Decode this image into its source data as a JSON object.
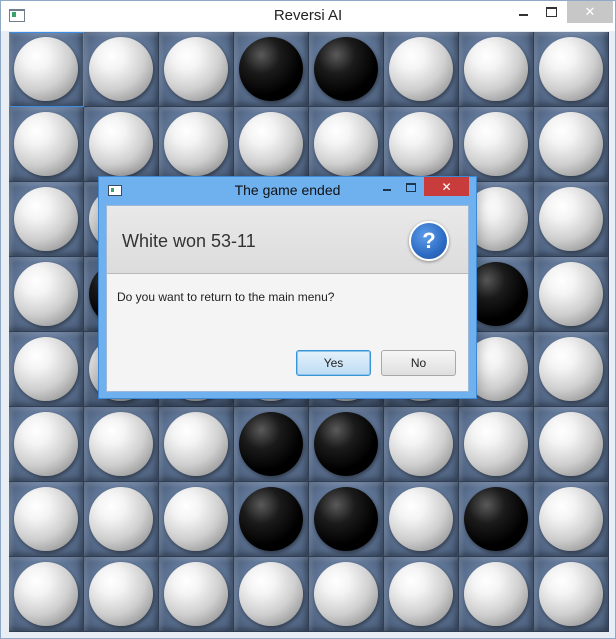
{
  "window": {
    "title": "Reversi AI",
    "close_glyph": "✕"
  },
  "board": {
    "rows": 8,
    "cols": 8,
    "selected_cell": [
      0,
      0
    ],
    "cells": [
      [
        "white",
        "white",
        "white",
        "black",
        "black",
        "white",
        "white",
        "white"
      ],
      [
        "white",
        "white",
        "white",
        "white",
        "white",
        "white",
        "white",
        "white"
      ],
      [
        "white",
        "white",
        "white",
        "white",
        "white",
        "white",
        "white",
        "white"
      ],
      [
        "white",
        "black",
        "white",
        "white",
        "white",
        "white",
        "black",
        "white"
      ],
      [
        "white",
        "white",
        "white",
        "white",
        "white",
        "white",
        "white",
        "white"
      ],
      [
        "white",
        "white",
        "white",
        "black",
        "black",
        "white",
        "white",
        "white"
      ],
      [
        "white",
        "white",
        "white",
        "black",
        "black",
        "white",
        "black",
        "white"
      ],
      [
        "white",
        "white",
        "white",
        "white",
        "white",
        "white",
        "white",
        "white"
      ]
    ]
  },
  "dialog": {
    "title": "The game ended",
    "headline": "White won 53-11",
    "message": "Do you want to return to the main menu?",
    "icon": "question-icon",
    "icon_glyph": "?",
    "close_glyph": "✕",
    "buttons": {
      "yes": "Yes",
      "no": "No"
    }
  },
  "colors": {
    "board": "#4d6585",
    "dialog_frame": "#6fb1ee",
    "close_button": "#c93c3c",
    "default_button": "#3a95d6"
  }
}
